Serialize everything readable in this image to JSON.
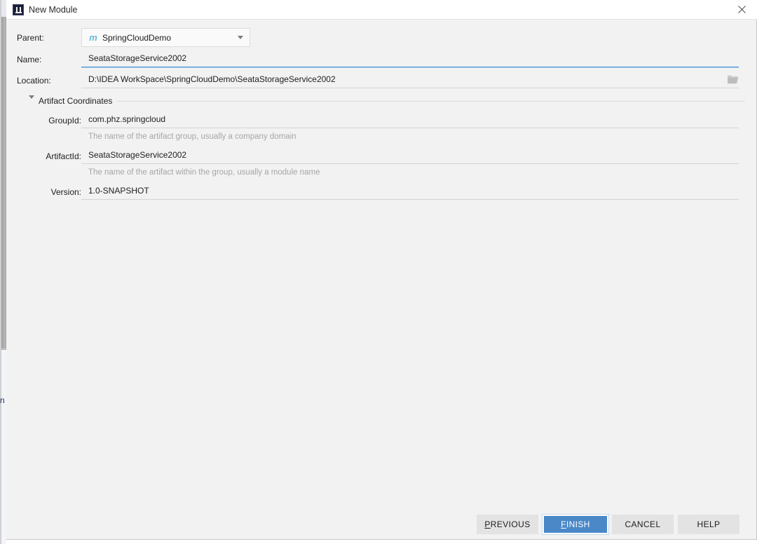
{
  "window": {
    "title": "New Module",
    "icon": "intellij-idea-icon",
    "close_label": "×",
    "bg_glyph": "n"
  },
  "form": {
    "parent": {
      "label": "Parent:",
      "value": "SpringCloudDemo",
      "icon": "maven-module-icon",
      "icon_glyph": "m"
    },
    "name": {
      "label": "Name:",
      "value": "SeataStorageService2002",
      "focused": true
    },
    "location": {
      "label": "Location:",
      "value": "D:\\IDEA WorkSpace\\SpringCloudDemo\\SeataStorageService2002",
      "browse_icon": "folder-icon"
    }
  },
  "artifact_section": {
    "title": "Artifact Coordinates",
    "expanded": true,
    "group_id": {
      "label": "GroupId:",
      "value": "com.phz.springcloud",
      "hint": "The name of the artifact group, usually a company domain"
    },
    "artifact_id": {
      "label": "ArtifactId:",
      "value": "SeataStorageService2002",
      "hint": "The name of the artifact within the group, usually a module name"
    },
    "version": {
      "label": "Version:",
      "value": "1.0-SNAPSHOT"
    }
  },
  "buttons": {
    "previous": {
      "prefix": "",
      "mnemonic": "P",
      "suffix": "REVIOUS"
    },
    "finish": {
      "prefix": "",
      "mnemonic": "F",
      "suffix": "INISH"
    },
    "cancel": {
      "label": "CANCEL"
    },
    "help": {
      "label": "HELP"
    }
  },
  "colors": {
    "accent": "#4a88c7",
    "focus_underline": "#4a90d9",
    "dialog_bg": "#f2f2f2",
    "titlebar_bg": "#ffffff",
    "maven_icon": "#6bb6d6",
    "hint_text": "#a6a6a6"
  }
}
